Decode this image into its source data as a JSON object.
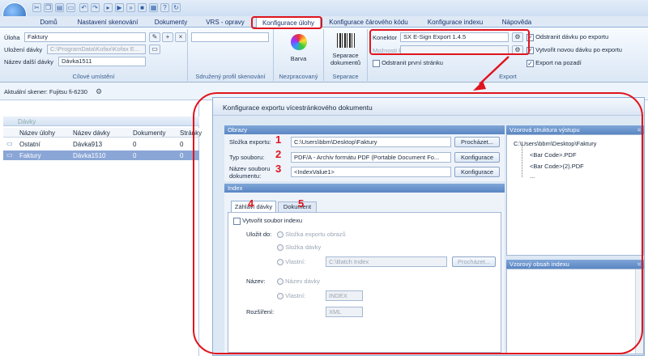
{
  "quick_access": {
    "icons": [
      "cut-icon",
      "copy-icon",
      "paste-icon",
      "document-icon",
      "undo-icon",
      "redo-icon",
      "forward-icon",
      "play-icon",
      "stop-icon",
      "grid-icon",
      "help-icon",
      "refresh-icon"
    ]
  },
  "tabs": [
    "Domů",
    "Nastavení skenování",
    "Dokumenty",
    "VRS - opravy",
    "Konfigurace úlohy",
    "Konfigurace čárového kódu",
    "Konfigurace indexu",
    "Nápověda"
  ],
  "ribbon": {
    "cil": {
      "uloha_label": "Úloha",
      "uloha_value": "Faktury",
      "ulozeni_label": "Uložení dávky",
      "ulozeni_value": "C:\\ProgramData\\Kofax\\Kofax E...",
      "nazev_label": "Název další dávky",
      "nazev_value": "Dávka1511",
      "group_label": "Cílové umístění"
    },
    "profil": {
      "group_label": "Sdružený profil skenování"
    },
    "barva": {
      "label": "Barva",
      "group_label": "Nezpracovaný"
    },
    "separace": {
      "label": "Separace dokumentů",
      "group_label": "Separace"
    },
    "export": {
      "konektor_label": "Konektor",
      "konektor_value": "SX E-Sign Export 1.4.5",
      "moznosti_label": "Možnosti PDF",
      "odstranit_prvni": "Odstranit první stránku",
      "odstranit_davku": "Odstranit dávku po exportu",
      "vytvorit_davku": "Vytvořit novou dávku po exportu",
      "export_pozadi": "Export na pozadí",
      "group_label": "Export"
    }
  },
  "scanner": "Aktuální skener: Fujitsu fi-6230",
  "left_panel": {
    "header": "Dávky",
    "columns": [
      "Název úlohy",
      "Název dávky",
      "Dokumenty",
      "Stránky"
    ],
    "rows": [
      [
        "Ostatní",
        "Dávka913",
        "0",
        "0"
      ],
      [
        "Faktury",
        "Dávka1510",
        "0",
        "0"
      ]
    ]
  },
  "dialog": {
    "title": "Konfigurace exportu vícestránkového dokumentu",
    "obrazy": {
      "header": "Obrazy",
      "slozka_label": "Složka exportu:",
      "slozka_value": "C:\\Users\\bbm\\Desktop\\Faktury",
      "prochazet": "Procházet...",
      "typ_label": "Typ souboru:",
      "typ_value": "PDF/A - Archiv formátu PDF (Portable Document Fo...",
      "konfigurace": "Konfigurace",
      "nazev_label": "Název souboru dokumentu:",
      "nazev_value": "<IndexValue1>"
    },
    "index": {
      "header": "Index",
      "tab1": "Záhlaví dávky",
      "tab2": "Dokument",
      "vytvorit": "Vytvořit soubor indexu",
      "ulozit_do": "Uložit do:",
      "opt_slozka_exportu": "Složka exportu obrazů",
      "opt_slozka_davky": "Složka dávky",
      "opt_vlastni": "Vlastní:",
      "vlastni_value": "C:\\Batch Index",
      "prochazet": "Procházet...",
      "nazev_label": "Název:",
      "opt_nazev_davky": "Název dávky",
      "opt_vlastni2": "Vlastní:",
      "vlastni2_value": "INDEX",
      "rozsireni_label": "Rozšíření:",
      "rozsireni_value": "XML"
    },
    "struktura": {
      "header": "Vzorová struktura výstupu",
      "root": "C:\\Users\\bbm\\Desktop\\Faktury",
      "items": [
        "<Bar Code>.PDF",
        "<Bar Code>(2).PDF",
        "..."
      ]
    },
    "obsah": {
      "header": "Vzorový obsah indexu"
    }
  },
  "annotations": [
    "1",
    "2",
    "3",
    "4",
    "5"
  ]
}
